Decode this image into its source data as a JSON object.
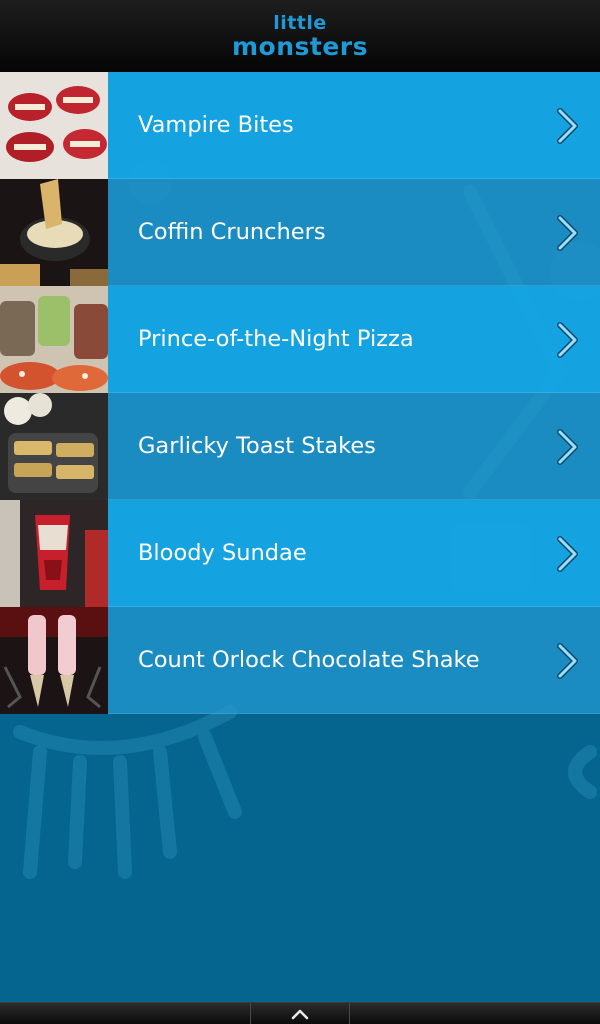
{
  "header": {
    "logo_top": "little",
    "logo_bottom": "monsters"
  },
  "colors": {
    "header_bg": "#0a0a0a",
    "logo": "#1f9ad6",
    "row_primary": "#16a8e6",
    "row_secondary": "#2096cd",
    "background": "#05658f"
  },
  "recipes": [
    {
      "label": "Vampire Bites",
      "thumb": "vampire-bites-photo"
    },
    {
      "label": "Coffin Crunchers",
      "thumb": "coffin-crunchers-photo"
    },
    {
      "label": "Prince-of-the-Night Pizza",
      "thumb": "pizza-photo"
    },
    {
      "label": "Garlicky Toast Stakes",
      "thumb": "toast-stakes-photo"
    },
    {
      "label": "Bloody Sundae",
      "thumb": "bloody-sundae-photo"
    },
    {
      "label": "Count Orlock Chocolate Shake",
      "thumb": "chocolate-shake-photo"
    }
  ],
  "footer": {
    "icon": "chevron-up-icon"
  }
}
